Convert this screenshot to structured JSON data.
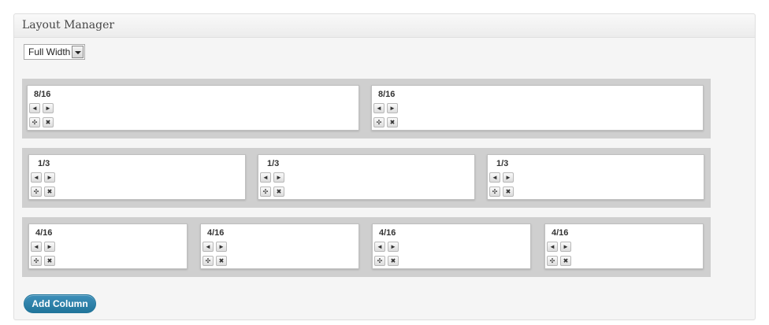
{
  "panel": {
    "title": "Layout Manager"
  },
  "layout_select": {
    "value": "Full Width"
  },
  "icons": {
    "left": "◄",
    "right": "►",
    "move": "✣",
    "remove": "✖"
  },
  "rows": [
    {
      "columns": [
        {
          "label": "8/16"
        },
        {
          "label": "8/16"
        }
      ]
    },
    {
      "columns": [
        {
          "label": "1/3"
        },
        {
          "label": "1/3"
        },
        {
          "label": "1/3"
        }
      ]
    },
    {
      "columns": [
        {
          "label": "4/16"
        },
        {
          "label": "4/16"
        },
        {
          "label": "4/16"
        },
        {
          "label": "4/16"
        }
      ]
    }
  ],
  "actions": {
    "add_column_label": "Add Column"
  },
  "colors": {
    "accent": "#21759b",
    "row_background": "#cfcfcf"
  }
}
